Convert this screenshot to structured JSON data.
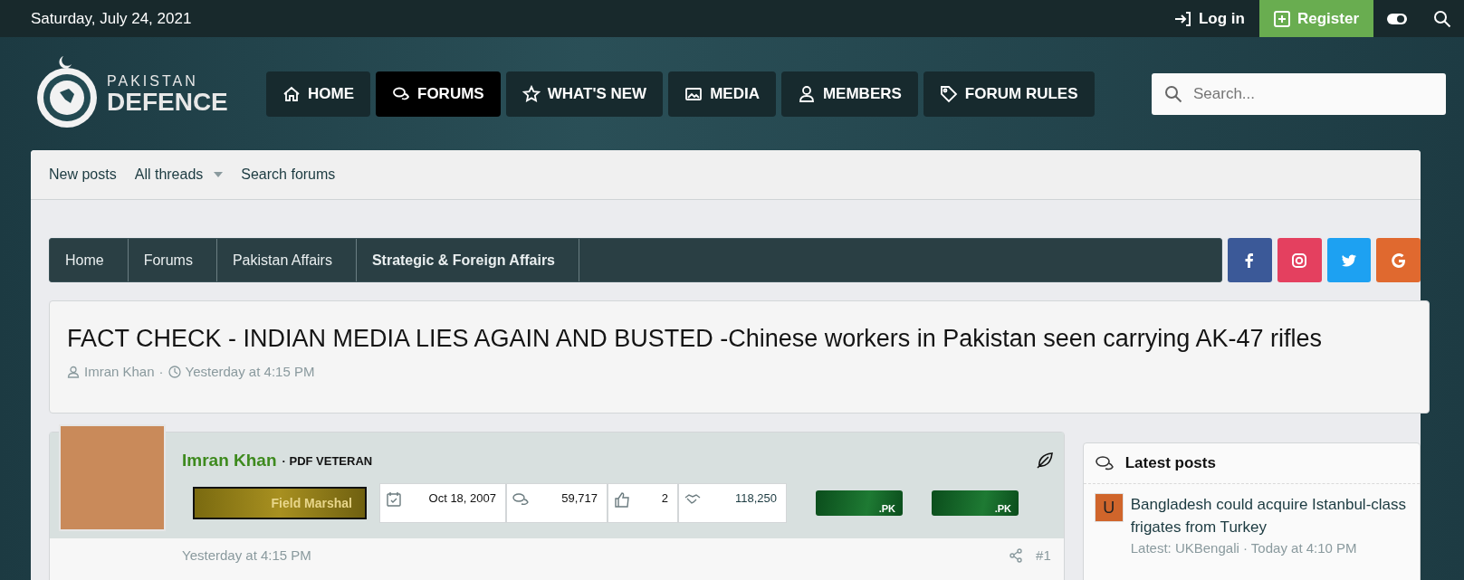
{
  "top_bar": {
    "date": "Saturday, July 24, 2021",
    "login": "Log in",
    "register": "Register"
  },
  "logo": {
    "line_1": "PAKISTAN",
    "line_2": "DEFENCE"
  },
  "nav": [
    {
      "label": "HOME",
      "kind": "home",
      "selected": false
    },
    {
      "label": "FORUMS",
      "kind": "forums",
      "selected": true
    },
    {
      "label": "WHAT'S NEW",
      "kind": "star",
      "selected": false
    },
    {
      "label": "MEDIA",
      "kind": "image",
      "selected": false
    },
    {
      "label": "MEMBERS",
      "kind": "user",
      "selected": false
    },
    {
      "label": "FORUM RULES",
      "kind": "tag",
      "selected": false
    }
  ],
  "search": {
    "placeholder": "Search..."
  },
  "sub_nav": [
    {
      "label": "New posts",
      "dropdown": false
    },
    {
      "label": "All threads",
      "dropdown": true
    },
    {
      "label": "Search forums",
      "dropdown": false
    }
  ],
  "breadcrumb": [
    {
      "label": "Home",
      "current": false
    },
    {
      "label": "Forums",
      "current": false
    },
    {
      "label": "Pakistan Affairs",
      "current": false
    },
    {
      "label": "Strategic & Foreign Affairs",
      "current": true
    }
  ],
  "social": [
    {
      "kind": "facebook",
      "color": "#3b5998"
    },
    {
      "kind": "instagram",
      "color": "#e4405f"
    },
    {
      "kind": "twitter",
      "color": "#1da1f2"
    },
    {
      "kind": "google",
      "color": "#e0692f"
    }
  ],
  "thread": {
    "title": "FACT CHECK - INDIAN MEDIA LIES AGAIN AND BUSTED -Chinese workers in Pakistan seen carrying AK-47 rifles",
    "author": "Imran Khan",
    "separator": "·",
    "date": "Yesterday at 4:15 PM"
  },
  "post": {
    "username": "Imran Khan",
    "user_title": "· PDF VETERAN",
    "rank": "Field Marshal",
    "stats": [
      {
        "kind": "joined",
        "value": "Oct 18, 2007"
      },
      {
        "kind": "messages",
        "value": "59,717"
      },
      {
        "kind": "reactions",
        "value": "2"
      },
      {
        "kind": "points",
        "value": "118,250"
      }
    ],
    "flags": [
      ".PK",
      ".PK"
    ],
    "date": "Yesterday at 4:15 PM",
    "number": "#1"
  },
  "sidebar": {
    "title": "Latest posts",
    "items": [
      {
        "avatar_letter": "U",
        "title": "Bangladesh could acquire Istanbul-class frigates from Turkey",
        "meta": "Latest: UKBengali · Today at 4:10 PM"
      }
    ]
  }
}
